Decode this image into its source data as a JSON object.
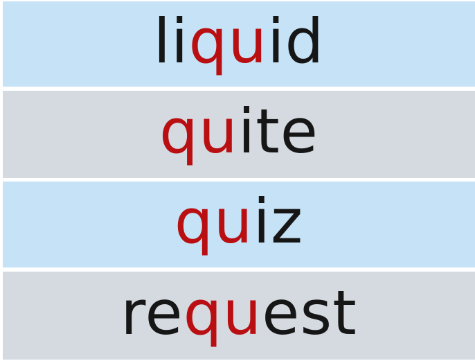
{
  "colors": {
    "blue_row": "#c6e2f6",
    "gray_row": "#d5dae0",
    "plain_text": "#161616",
    "highlight_text": "#b90f12"
  },
  "words": [
    {
      "pre": "li",
      "qu": "qu",
      "post": "id",
      "bg": "blue"
    },
    {
      "pre": "",
      "qu": "qu",
      "post": "ite",
      "bg": "gray"
    },
    {
      "pre": "",
      "qu": "qu",
      "post": "iz",
      "bg": "blue"
    },
    {
      "pre": "re",
      "qu": "qu",
      "post": "est",
      "bg": "gray"
    }
  ]
}
